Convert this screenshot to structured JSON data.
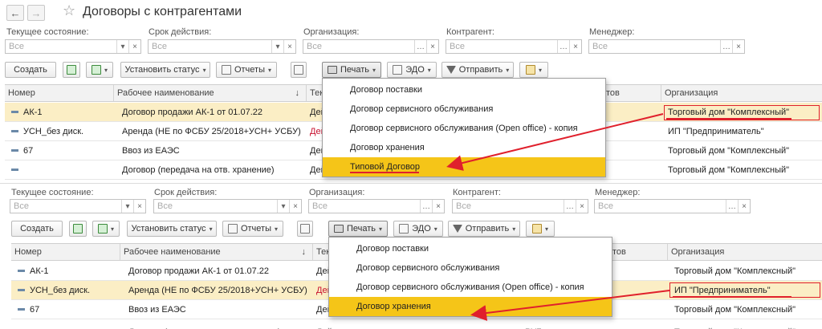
{
  "window": {
    "title": "Договоры с контрагентами"
  },
  "filters": [
    {
      "label": "Текущее состояние:",
      "placeholder": "Все"
    },
    {
      "label": "Срок действия:",
      "placeholder": "Все"
    },
    {
      "label": "Организация:",
      "placeholder": "Все"
    },
    {
      "label": "Контрагент:",
      "placeholder": "Все"
    },
    {
      "label": "Менеджер:",
      "placeholder": "Все"
    }
  ],
  "toolbar": {
    "create": "Создать",
    "set_status": "Установить статус",
    "reports": "Отчеты",
    "print": "Печать",
    "edo": "ЭДО",
    "send": "Отправить"
  },
  "columns": {
    "number": "Номер",
    "work_name": "Рабочее наименование",
    "type_short": "Тек",
    "hidden_short": "тов",
    "organization": "Организация"
  },
  "rows": [
    {
      "number": "АК-1",
      "name": "Договор продажи АК-1 от 01.07.22",
      "type": "Дей",
      "org": "Торговый дом \"Комплексный\""
    },
    {
      "number": "УСН_без диск.",
      "name": "Аренда (НЕ по ФСБУ 25/2018+УСН+ УСБУ)",
      "type": "Дей",
      "org": "ИП \"Предприниматель\""
    },
    {
      "number": "67",
      "name": "Ввоз из ЕАЭС",
      "type": "Дей",
      "org": "Торговый дом \"Комплексный\""
    },
    {
      "number": "",
      "name": "Договор (передача на отв. хранение)",
      "type": "Дей",
      "org": "Торговый дом \"Комплексный\""
    }
  ],
  "bottom_partial_row": {
    "name": "Договор (передача на отв. хранение)",
    "type": "Действ",
    "extra": "РУБ",
    "org": "Торговый дом \"Комплексный\""
  },
  "print_menu": [
    "Договор поставки",
    "Договор сервисного обслуживания",
    "Договор сервисного обслуживания (Open office) - копия",
    "Договор хранения",
    "Типовой Договор"
  ],
  "colors": {
    "menu_highlight": "#f5c518",
    "row_selected": "#fbeec5",
    "annotation_red": "#e0202c"
  }
}
